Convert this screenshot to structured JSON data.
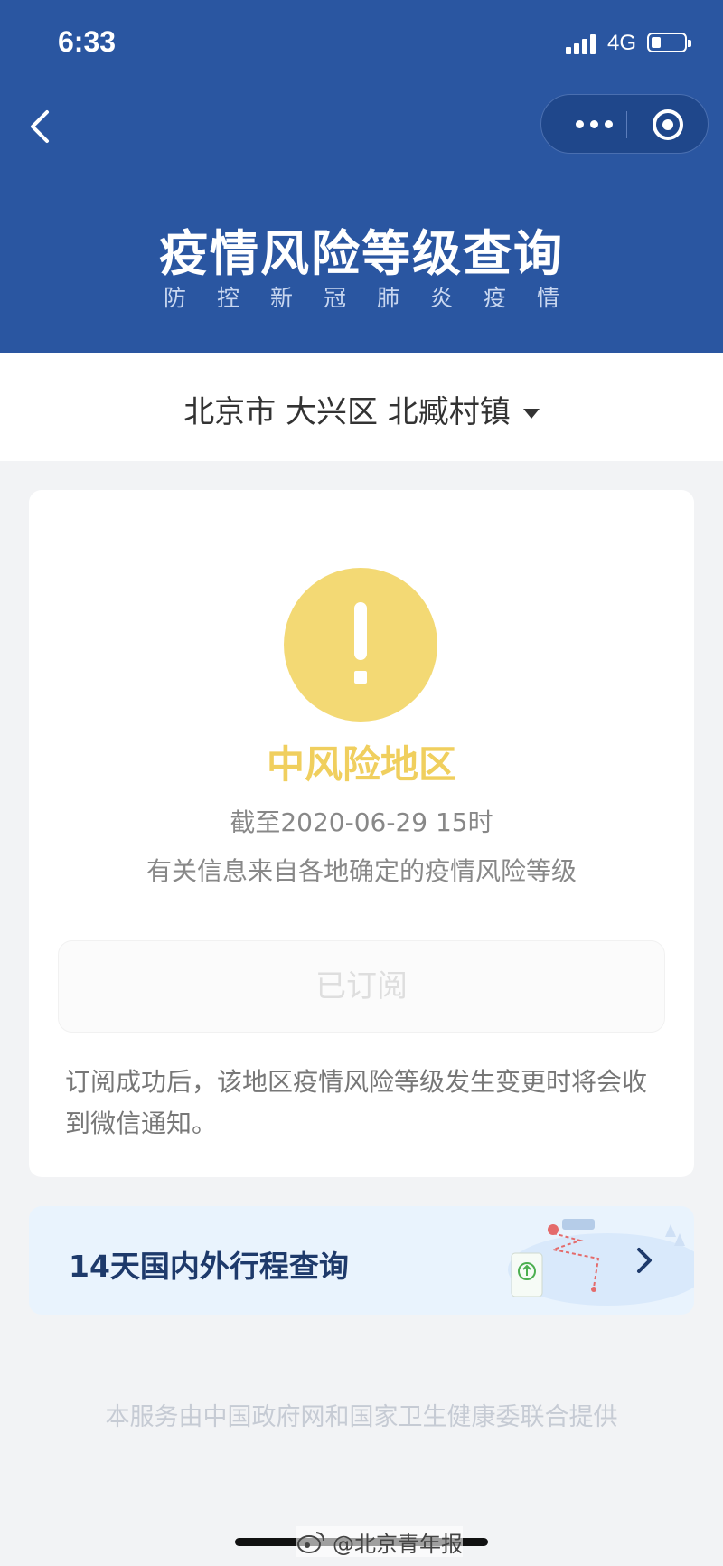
{
  "status_bar": {
    "time": "6:33",
    "network": "4G"
  },
  "banner": {
    "title": "疫情风险等级查询",
    "subtitle": "防控新冠肺炎疫情"
  },
  "region": {
    "selected": "北京市 大兴区 北臧村镇"
  },
  "risk_card": {
    "level": "中风险地区",
    "as_of": "截至2020-06-29 15时",
    "source_note": "有关信息来自各地确定的疫情风险等级",
    "subscribe_label": "已订阅",
    "subscribe_note": "订阅成功后，该地区疫情风险等级发生变更时将会收到微信通知。",
    "level_color": "#f3d974"
  },
  "itinerary": {
    "label": "14天国内外行程查询"
  },
  "footer": {
    "text": "本服务由中国政府网和国家卫生健康委联合提供"
  },
  "watermark": {
    "text": "@北京青年报"
  },
  "colors": {
    "header": "#2a56a1",
    "risk_medium": "#f0cf5e",
    "background": "#f2f3f5"
  }
}
